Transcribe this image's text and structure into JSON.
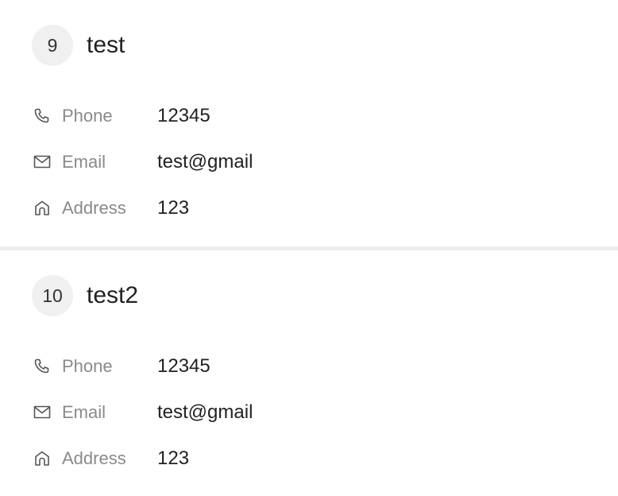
{
  "contacts": [
    {
      "index": "9",
      "name": "test",
      "fields": [
        {
          "icon": "phone-icon",
          "label": "Phone",
          "value": "12345"
        },
        {
          "icon": "mail-icon",
          "label": "Email",
          "value": "test@gmail"
        },
        {
          "icon": "home-icon",
          "label": "Address",
          "value": "123"
        }
      ]
    },
    {
      "index": "10",
      "name": "test2",
      "fields": [
        {
          "icon": "phone-icon",
          "label": "Phone",
          "value": "12345"
        },
        {
          "icon": "mail-icon",
          "label": "Email",
          "value": "test@gmail"
        },
        {
          "icon": "home-icon",
          "label": "Address",
          "value": "123"
        }
      ]
    }
  ],
  "colors": {
    "badge_background": "#f0f0f0",
    "label_text": "#8a8a8a",
    "value_text": "#222222",
    "divider": "#eeeeee"
  }
}
